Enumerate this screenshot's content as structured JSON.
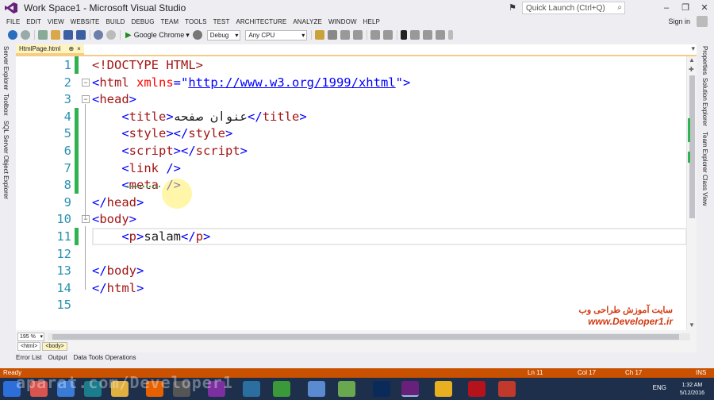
{
  "window": {
    "title": "Work Space1 - Microsoft Visual Studio",
    "quick_launch_placeholder": "Quick Launch (Ctrl+Q)",
    "sign_in": "Sign in"
  },
  "menu": [
    "FILE",
    "EDIT",
    "VIEW",
    "WEBSITE",
    "BUILD",
    "DEBUG",
    "TEAM",
    "TOOLS",
    "TEST",
    "ARCHITECTURE",
    "ANALYZE",
    "WINDOW",
    "HELP"
  ],
  "toolbar": {
    "run_target": "Google Chrome",
    "configuration": "Debug",
    "platform": "Any CPU"
  },
  "left_rail": [
    "Server Explorer",
    "Toolbox",
    "SQL Server Object Explorer"
  ],
  "right_rail": [
    "Properties",
    "Solution Explorer",
    "Team Explorer",
    "Class View"
  ],
  "document_tab": {
    "name": "HtmlPage.html",
    "pin": "⊕",
    "close": "×"
  },
  "code_lines": [
    {
      "n": "1",
      "parts": [
        [
          "t",
          "<!DOCTYPE HTML>"
        ]
      ]
    },
    {
      "n": "2",
      "parts": [
        [
          "d",
          "<"
        ],
        [
          "t",
          "html"
        ],
        [
          "a",
          " xmlns"
        ],
        [
          "d",
          "=\""
        ],
        [
          "u",
          "http://www.w3.org/1999/xhtml"
        ],
        [
          "d",
          "\">"
        ]
      ]
    },
    {
      "n": "3",
      "parts": [
        [
          "d",
          "<"
        ],
        [
          "t",
          "head"
        ],
        [
          "d",
          ">"
        ]
      ]
    },
    {
      "n": "4",
      "parts": [
        [
          "k",
          "    "
        ],
        [
          "d",
          "<"
        ],
        [
          "t",
          "title"
        ],
        [
          "d",
          ">"
        ],
        [
          "k",
          "عنوان صفحه"
        ],
        [
          "d",
          "</"
        ],
        [
          "t",
          "title"
        ],
        [
          "d",
          ">"
        ]
      ]
    },
    {
      "n": "5",
      "parts": [
        [
          "k",
          "    "
        ],
        [
          "d",
          "<"
        ],
        [
          "t",
          "style"
        ],
        [
          "d",
          "></"
        ],
        [
          "t",
          "style"
        ],
        [
          "d",
          ">"
        ]
      ]
    },
    {
      "n": "6",
      "parts": [
        [
          "k",
          "    "
        ],
        [
          "d",
          "<"
        ],
        [
          "t",
          "script"
        ],
        [
          "d",
          "></"
        ],
        [
          "t",
          "script"
        ],
        [
          "d",
          ">"
        ]
      ]
    },
    {
      "n": "7",
      "parts": [
        [
          "k",
          "    "
        ],
        [
          "d",
          "<"
        ],
        [
          "t",
          "link"
        ],
        [
          "k",
          " "
        ],
        [
          "d",
          "/>"
        ]
      ]
    },
    {
      "n": "8",
      "parts": [
        [
          "k",
          "    "
        ],
        [
          "d",
          "<"
        ],
        [
          "t",
          "meta"
        ],
        [
          "k",
          " "
        ],
        [
          "d",
          "/>"
        ]
      ]
    },
    {
      "n": "9",
      "parts": [
        [
          "d",
          "</"
        ],
        [
          "t",
          "head"
        ],
        [
          "d",
          ">"
        ]
      ]
    },
    {
      "n": "10",
      "parts": [
        [
          "d",
          "<"
        ],
        [
          "t",
          "body"
        ],
        [
          "d",
          ">"
        ]
      ]
    },
    {
      "n": "11",
      "parts": [
        [
          "k",
          "    "
        ],
        [
          "d",
          "<"
        ],
        [
          "t",
          "p"
        ],
        [
          "d",
          ">"
        ],
        [
          "k",
          "salam"
        ],
        [
          "d",
          "</"
        ],
        [
          "t",
          "p"
        ],
        [
          "d",
          ">"
        ]
      ]
    },
    {
      "n": "12",
      "parts": []
    },
    {
      "n": "13",
      "parts": [
        [
          "d",
          "</"
        ],
        [
          "t",
          "body"
        ],
        [
          "d",
          ">"
        ]
      ]
    },
    {
      "n": "14",
      "parts": [
        [
          "d",
          "</"
        ],
        [
          "t",
          "html"
        ],
        [
          "d",
          ">"
        ]
      ]
    },
    {
      "n": "15",
      "parts": []
    }
  ],
  "watermark": {
    "line1": "سایت آموزش طراحی وب",
    "line2": "www.Developer1.ir"
  },
  "editor_footer": {
    "zoom": "195 %",
    "breadcrumbs": [
      "<html>",
      "<body>"
    ]
  },
  "panel_tabs": [
    "Error List",
    "Output",
    "Data Tools Operations"
  ],
  "status": {
    "state": "Ready",
    "line": "Ln 11",
    "col": "Col 17",
    "ch": "Ch 17",
    "mode": "INS"
  },
  "taskbar": {
    "watermark": "aparat.com/Developer1",
    "language": "ENG",
    "time": "1:32 AM",
    "date": "5/12/2016"
  },
  "colors": {
    "status_bar": "#ca5100",
    "change_margin": "#2fb24f",
    "tag": "#a31515",
    "delimiter": "#0000ff",
    "attribute": "#ff0000",
    "line_number": "#2b91af"
  }
}
